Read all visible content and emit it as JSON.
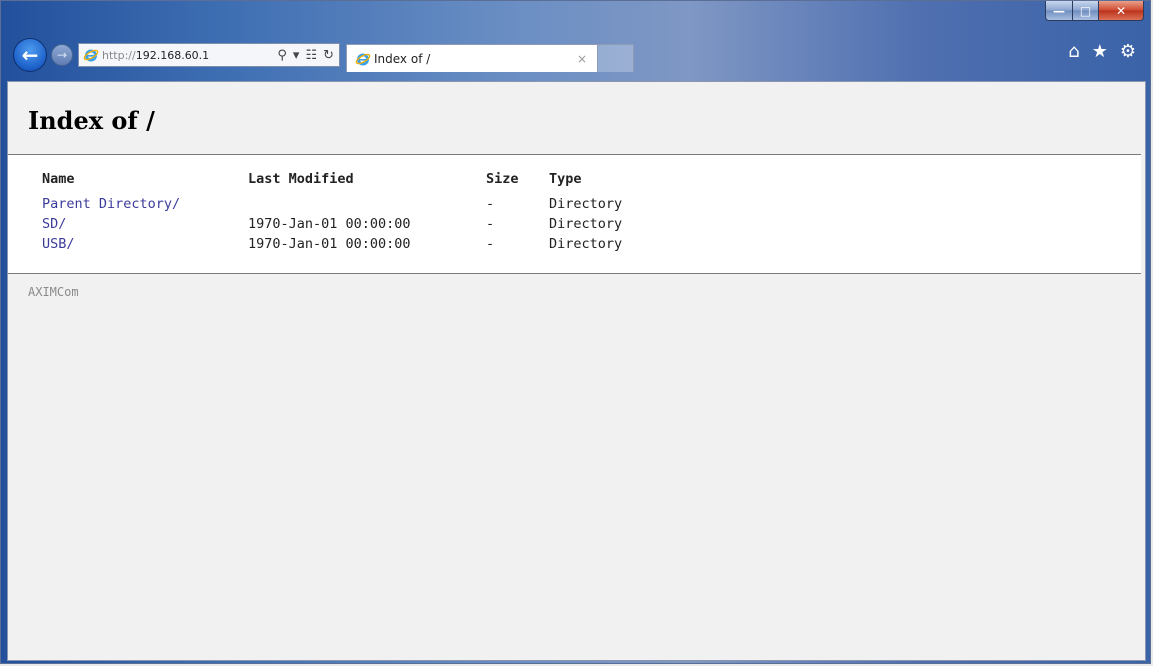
{
  "browser": {
    "address": {
      "protocol": "http://",
      "host": "192.168.60.1"
    },
    "tab": {
      "title": "Index of /",
      "close": "×"
    }
  },
  "page": {
    "title": "Index of /",
    "columns": {
      "name": "Name",
      "modified": "Last Modified",
      "size": "Size",
      "type": "Type"
    },
    "rows": [
      {
        "name": "Parent Directory/",
        "modified": "",
        "size": "-",
        "type": "Directory"
      },
      {
        "name": "SD/",
        "modified": "1970-Jan-01 00:00:00",
        "size": "-",
        "type": "Directory"
      },
      {
        "name": "USB/",
        "modified": "1970-Jan-01 00:00:00",
        "size": "-",
        "type": "Directory"
      }
    ],
    "footer": "AXIMCom"
  }
}
